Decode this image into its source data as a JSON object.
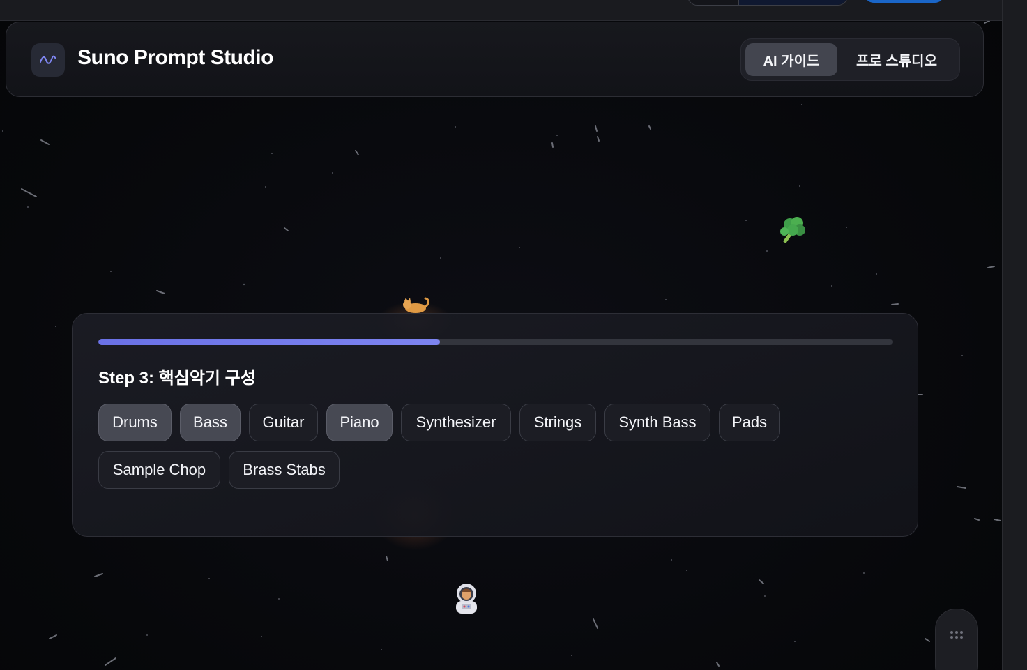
{
  "app": {
    "title": "Suno Prompt Studio",
    "logo_icon": "waveform-icon"
  },
  "mode_toggle": {
    "options": [
      {
        "label": "AI 가이드",
        "active": true
      },
      {
        "label": "프로 스튜디오",
        "active": false
      }
    ]
  },
  "wizard": {
    "progress_percent": 43,
    "step_title": "Step 3: 핵심악기 구성",
    "instruments": [
      {
        "label": "Drums",
        "selected": true
      },
      {
        "label": "Bass",
        "selected": true
      },
      {
        "label": "Guitar",
        "selected": false
      },
      {
        "label": "Piano",
        "selected": true
      },
      {
        "label": "Synthesizer",
        "selected": false
      },
      {
        "label": "Strings",
        "selected": false
      },
      {
        "label": "Synth Bass",
        "selected": false
      },
      {
        "label": "Pads",
        "selected": false
      },
      {
        "label": "Sample Chop",
        "selected": false
      },
      {
        "label": "Brass Stabs",
        "selected": false
      }
    ]
  },
  "decorations": {
    "floating_emojis": [
      "broccoli",
      "cat",
      "astronaut"
    ]
  },
  "colors": {
    "accent": "#6a71e6",
    "background": "#06070a",
    "chip_selected": "#474953"
  }
}
